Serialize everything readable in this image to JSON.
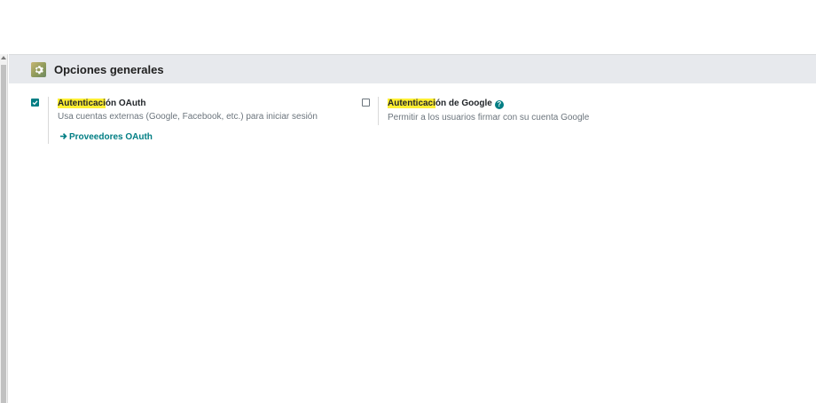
{
  "section": {
    "title": "Opciones generales",
    "icon": "gear-icon"
  },
  "settings": [
    {
      "label_highlight": "Autenticaci",
      "label_rest": "ón OAuth",
      "description": "Usa cuentas externas (Google, Facebook, etc.) para iniciar sesión",
      "checked": true,
      "link": "Proveedores OAuth"
    },
    {
      "label_highlight": "Autenticaci",
      "label_rest": "ón de Google",
      "description": "Permitir a los usuarios firmar con su cuenta Google",
      "checked": false,
      "help_glyph": "?"
    }
  ],
  "colors": {
    "accent": "#017e84",
    "highlight": "#ffef33",
    "header_bg": "#e7e9ed"
  }
}
